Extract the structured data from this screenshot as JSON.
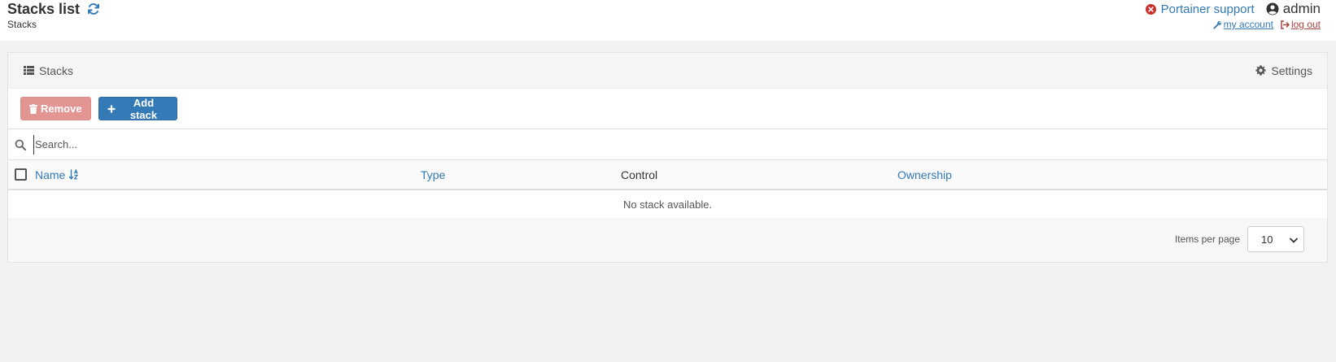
{
  "header": {
    "title": "Stacks list",
    "breadcrumb": "Stacks",
    "support_label": "Portainer support",
    "username": "admin",
    "my_account_label": " my account ",
    "logout_label": " log out"
  },
  "widget": {
    "title": "Stacks",
    "settings_label": "Settings",
    "remove_label": "Remove",
    "add_label": "Add stack",
    "search_placeholder": "Search...",
    "columns": {
      "name": "Name",
      "type": "Type",
      "control": "Control",
      "ownership": "Ownership"
    },
    "empty_message": "No stack available.",
    "items_per_page_label": "Items per page",
    "items_per_page_value": "10"
  },
  "colors": {
    "primary": "#337ab7",
    "danger_disabled": "#e39593",
    "logout": "#a94442"
  }
}
